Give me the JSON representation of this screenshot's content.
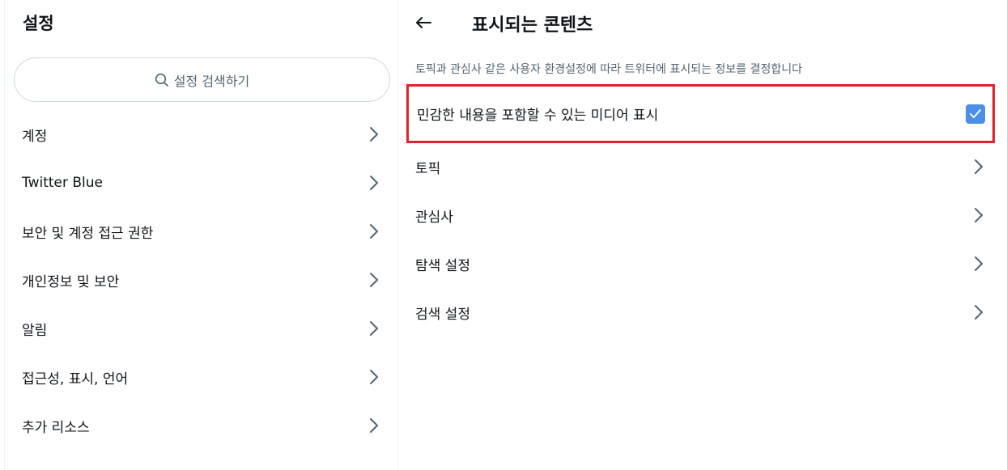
{
  "left": {
    "title": "설정",
    "search": {
      "placeholder": "설정 검색하기",
      "icon": "search-icon"
    },
    "items": [
      {
        "label": "계정"
      },
      {
        "label": "Twitter Blue"
      },
      {
        "label": "보안 및 계정 접근 권한"
      },
      {
        "label": "개인정보 및 보안"
      },
      {
        "label": "알림"
      },
      {
        "label": "접근성, 표시, 언어"
      },
      {
        "label": "추가 리소스"
      }
    ]
  },
  "right": {
    "title": "표시되는 콘텐츠",
    "description": "토픽과 관심사 같은 사용자 환경설정에 따라 트위터에 표시되는 정보를 결정합니다",
    "sensitive": {
      "label": "민감한 내용을 포함할 수 있는 미디어 표시",
      "checked": true
    },
    "items": [
      {
        "label": "토픽"
      },
      {
        "label": "관심사"
      },
      {
        "label": "탐색 설정"
      },
      {
        "label": "검색 설정"
      }
    ]
  },
  "colors": {
    "highlight_border": "#e0212e",
    "checkbox": "#4d8fe8",
    "secondary_text": "#536471"
  }
}
